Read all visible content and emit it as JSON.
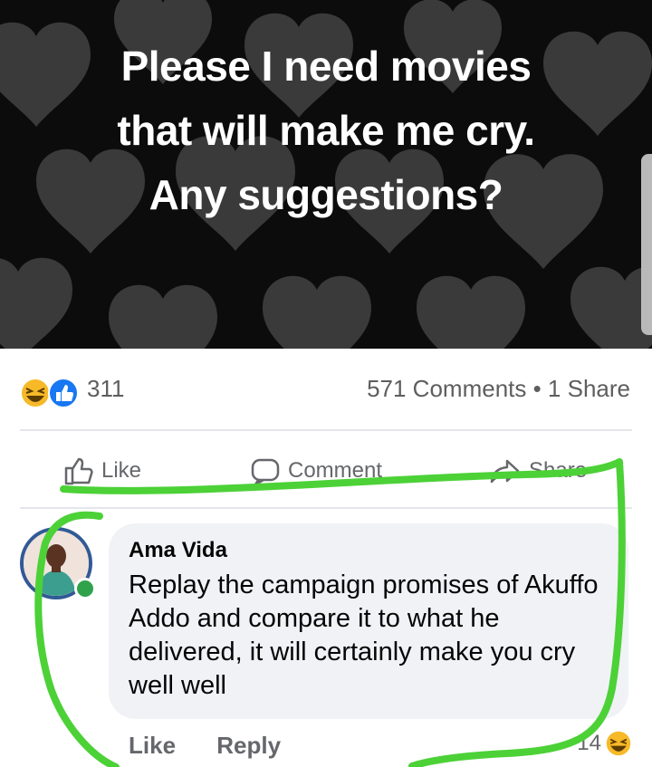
{
  "post": {
    "lines": [
      "Please I need movies",
      "that will make me cry.",
      "Any suggestions?"
    ]
  },
  "stats": {
    "reaction_count": "311",
    "comments_shares": "571 Comments • 1 Share"
  },
  "actions": {
    "like": "Like",
    "comment": "Comment",
    "share": "Share"
  },
  "comment": {
    "author": "Ama Vida",
    "text": "Replay the campaign promises of Akuffo Addo and compare it to what he delivered, it will certainly make you cry well well",
    "like": "Like",
    "reply": "Reply",
    "reaction_count": "14"
  },
  "colors": {
    "highlight": "#4cd137",
    "like_blue": "#1877f2",
    "haha_yellow": "#f7b928"
  }
}
